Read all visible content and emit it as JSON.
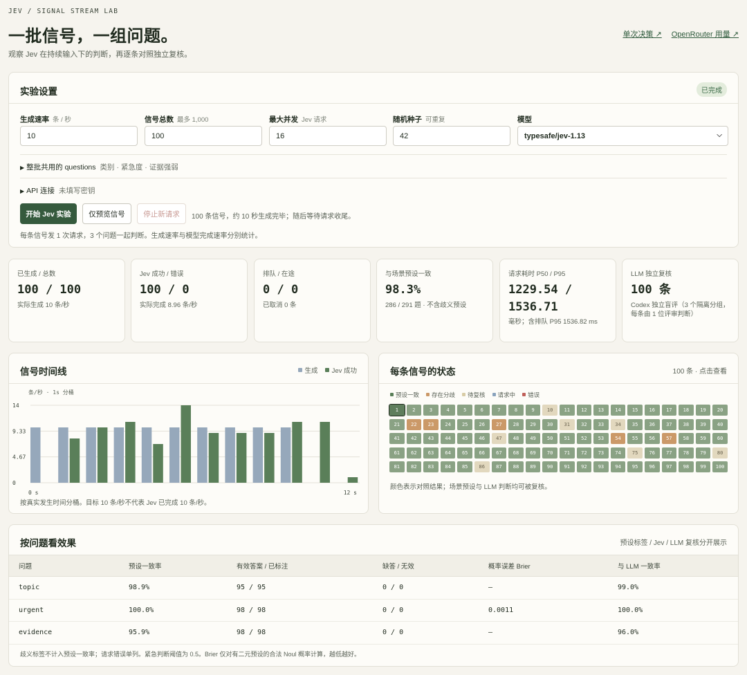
{
  "header": {
    "eyebrow": "JEV / SIGNAL STREAM LAB",
    "title": "一批信号，一组问题。",
    "subtitle": "观察 Jev 在持续输入下的判断，再逐条对照独立复核。",
    "links": [
      "单次决策 ↗",
      "OpenRouter 用量 ↗"
    ]
  },
  "settings": {
    "title": "实验设置",
    "status_badge": "已完成",
    "fields": [
      {
        "label": "生成速率",
        "hint": "条 / 秒",
        "value": "10"
      },
      {
        "label": "信号总数",
        "hint": "最多 1,000",
        "value": "100"
      },
      {
        "label": "最大并发",
        "hint": "Jev 请求",
        "value": "16"
      },
      {
        "label": "随机种子",
        "hint": "可重复",
        "value": "42"
      },
      {
        "label": "模型",
        "hint": "",
        "value": "typesafe/jev-1.13"
      }
    ],
    "questions_disclosure": {
      "label": "整批共用的 questions",
      "hint": "类别 · 紧急度 · 证据强弱"
    },
    "api_disclosure": {
      "label": "API 连接",
      "hint": "未填写密钥"
    },
    "buttons": {
      "start": "开始 Jev 实验",
      "preview": "仅预览信号",
      "stop": "停止新请求"
    },
    "run_note": "100 条信号，约 10 秒生成完毕；随后等待请求收尾。",
    "foot_note": "每条信号发 1 次请求，3 个问题一起判断。生成速率与模型完成速率分别统计。"
  },
  "stats": [
    {
      "label": "已生成 / 总数",
      "value": "100 / 100",
      "sub": "实际生成 10 条/秒"
    },
    {
      "label": "Jev 成功 / 错误",
      "value": "100 / 0",
      "sub": "实际完成 8.96 条/秒"
    },
    {
      "label": "排队 / 在途",
      "value": "0 / 0",
      "sub": "已取消 0 条"
    },
    {
      "label": "与场景预设一致",
      "value": "98.3%",
      "sub": "286 / 291 题 · 不含歧义预设"
    },
    {
      "label": "请求耗时 P50 / P95",
      "value": "1229.54 / 1536.71",
      "sub": "毫秒；含排队 P95 1536.82 ms"
    },
    {
      "label": "LLM 独立复核",
      "value": "100 条",
      "sub": "Codex 独立盲评（3 个隔离分组，每条由 1 位评审判断）"
    }
  ],
  "timeline": {
    "title": "信号时间线",
    "legend": [
      "生成",
      "Jev 成功"
    ],
    "unit_label": "条/秒 · 1s 分桶",
    "note": "按真实发生时间分桶。目标 10 条/秒不代表 Jev 已完成 10 条/秒。"
  },
  "chart_data": {
    "type": "bar",
    "categories": [
      "0",
      "1",
      "2",
      "3",
      "4",
      "5",
      "6",
      "7",
      "8",
      "9",
      "10",
      "11",
      "12"
    ],
    "series": [
      {
        "name": "生成",
        "color": "#96a8bb",
        "values": [
          10,
          10,
          10,
          10,
          10,
          10,
          10,
          10,
          10,
          10,
          0,
          0,
          0
        ]
      },
      {
        "name": "Jev 成功",
        "color": "#5a7f59",
        "values": [
          0,
          8,
          10,
          11,
          7,
          14,
          9,
          9,
          9,
          11,
          11,
          1,
          0
        ]
      }
    ],
    "yticks": [
      "0",
      "4.67",
      "9.33",
      "14"
    ],
    "xticks": [
      "0 s",
      "12 s"
    ],
    "ylim": [
      0,
      14
    ]
  },
  "status_grid": {
    "title": "每条信号的状态",
    "meta": "100 条 · 点击查看",
    "legend": [
      {
        "label": "预设一致",
        "color": "#5a7f59"
      },
      {
        "label": "存在分歧",
        "color": "#cb9968"
      },
      {
        "label": "待复核",
        "color": "#d8cca6"
      },
      {
        "label": "请求中",
        "color": "#8aa3bd"
      },
      {
        "label": "错误",
        "color": "#c0605a"
      }
    ],
    "split": [
      22,
      23,
      27,
      54,
      57
    ],
    "review": [
      10,
      31,
      34,
      47,
      75,
      80,
      86
    ],
    "selected": 1,
    "note": "颜色表示对照结果；场景预设与 LLM 判断均可被复核。"
  },
  "questions": {
    "title": "按问题看效果",
    "meta": "预设标签 / Jev / LLM 复核分开展示",
    "columns": [
      "问题",
      "预设一致率",
      "有效答案 / 已标注",
      "缺答 / 无效",
      "概率误差 Brier",
      "与 LLM 一致率"
    ],
    "rows": [
      [
        "topic",
        "98.9%",
        "95 / 95",
        "0 / 0",
        "—",
        "99.0%"
      ],
      [
        "urgent",
        "100.0%",
        "98 / 98",
        "0 / 0",
        "0.0011",
        "100.0%"
      ],
      [
        "evidence",
        "95.9%",
        "98 / 98",
        "0 / 0",
        "—",
        "96.0%"
      ]
    ],
    "note": "歧义标签不计入预设一致率；请求错误单列。紧急判断阈值为 0.5。Brier 仅对有二元预设的合法 Noul 概率计算，越低越好。"
  }
}
